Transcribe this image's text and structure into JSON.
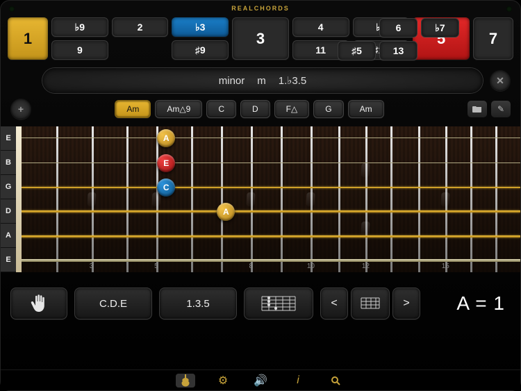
{
  "app_title": "REALCHORDS",
  "degrees": {
    "left": {
      "label": "1",
      "variant": "gold"
    },
    "right": {
      "label": "7",
      "variant": ""
    },
    "row1": [
      "♭9",
      "2",
      "♭3",
      "3",
      "4",
      "♭5",
      "5",
      "♯5",
      "6",
      "♭7"
    ],
    "row2": [
      "9",
      "",
      "♯9",
      "",
      "11",
      "♯11",
      "",
      "",
      "13",
      ""
    ],
    "row1_variants": [
      "",
      "",
      "blue",
      "",
      "",
      "",
      "red",
      "",
      "",
      ""
    ],
    "tall_positions": [
      false,
      false,
      false,
      true,
      false,
      false,
      false,
      false,
      false,
      false
    ]
  },
  "formula": {
    "name": "minor",
    "symbol": "m",
    "degrees": "1.♭3.5"
  },
  "chord_chips": [
    {
      "label": "Am",
      "active": true
    },
    {
      "label": "Am△9",
      "active": false
    },
    {
      "label": "C",
      "active": false
    },
    {
      "label": "D",
      "active": false
    },
    {
      "label": "F△",
      "active": false
    },
    {
      "label": "G",
      "active": false
    },
    {
      "label": "Am",
      "active": false
    }
  ],
  "string_labels": [
    "E",
    "B",
    "G",
    "D",
    "A",
    "E"
  ],
  "fret_numbers": [
    {
      "n": "3",
      "pct": 14
    },
    {
      "n": "5",
      "pct": 27
    },
    {
      "n": "8",
      "pct": 46
    },
    {
      "n": "10",
      "pct": 58
    },
    {
      "n": "12",
      "pct": 69
    },
    {
      "n": "15",
      "pct": 85
    }
  ],
  "notes": [
    {
      "label": "A",
      "string": 0,
      "pct": 29,
      "color": "gold"
    },
    {
      "label": "E",
      "string": 1,
      "pct": 29,
      "color": "red"
    },
    {
      "label": "C",
      "string": 2,
      "pct": 29,
      "color": "blue"
    },
    {
      "label": "A",
      "string": 3,
      "pct": 41,
      "color": "gold"
    }
  ],
  "highlight_strings": [
    2,
    3,
    4
  ],
  "bottom": {
    "hand_icon": "hand",
    "notes_btn": "C.D.E",
    "degrees_btn": "1.3.5",
    "nav_prev": "<",
    "nav_next": ">",
    "equation": "A = 1"
  },
  "icons": {
    "close": "✕",
    "add": "+",
    "folder": "📁",
    "pencil": "✎",
    "gear": "⚙",
    "sound": "🔊",
    "info": "i",
    "search": "🔍"
  }
}
